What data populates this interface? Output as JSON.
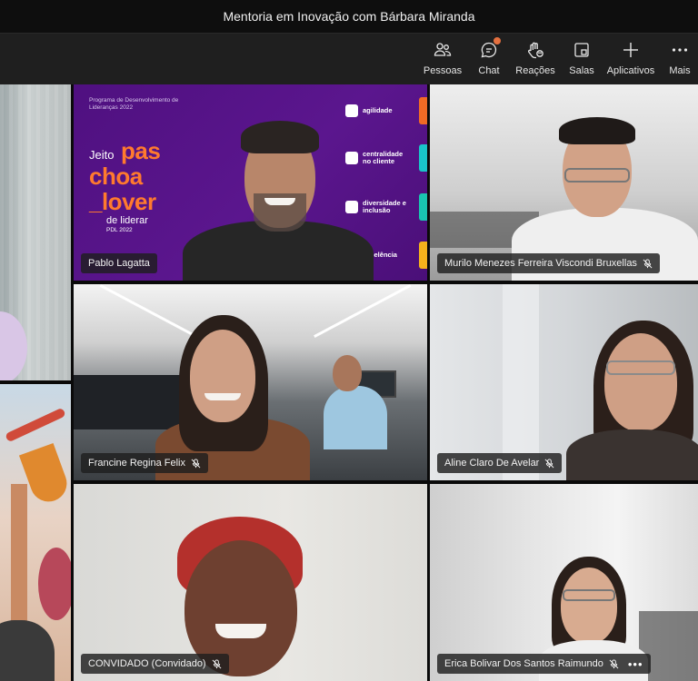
{
  "window": {
    "title": "Mentoria em Inovação com Bárbara Miranda"
  },
  "toolbar": {
    "people": "Pessoas",
    "chat": "Chat",
    "reactions": "Reações",
    "rooms": "Salas",
    "apps": "Aplicativos",
    "more": "Mais"
  },
  "participants": [
    {
      "name": "Pablo Lagatta",
      "muted": false
    },
    {
      "name": "Murilo Menezes Ferreira Viscondi Bruxellas",
      "muted": true
    },
    {
      "name": "Francine Regina Felix",
      "muted": true
    },
    {
      "name": "Aline Claro De Avelar",
      "muted": true
    },
    {
      "name": "CONVIDADO (Convidado)",
      "muted": true
    },
    {
      "name": "Erica Bolivar Dos Santos Raimundo",
      "muted": true
    }
  ],
  "banner": {
    "program": "Programa de Desenvolvimento de Lideranças 2022",
    "jeito": "Jeito",
    "word1": "pas",
    "word2": "choa",
    "word3": "_lover",
    "sub": "de liderar",
    "year": "PDL 2022",
    "pillars": [
      {
        "label": "agilidade",
        "color": "#f06a25"
      },
      {
        "label": "centralidade no cliente",
        "color": "#19c4c9"
      },
      {
        "label": "diversidade e inclusão",
        "color": "#19c4b0"
      },
      {
        "label": "excelência",
        "color": "#f5b21c"
      }
    ]
  }
}
